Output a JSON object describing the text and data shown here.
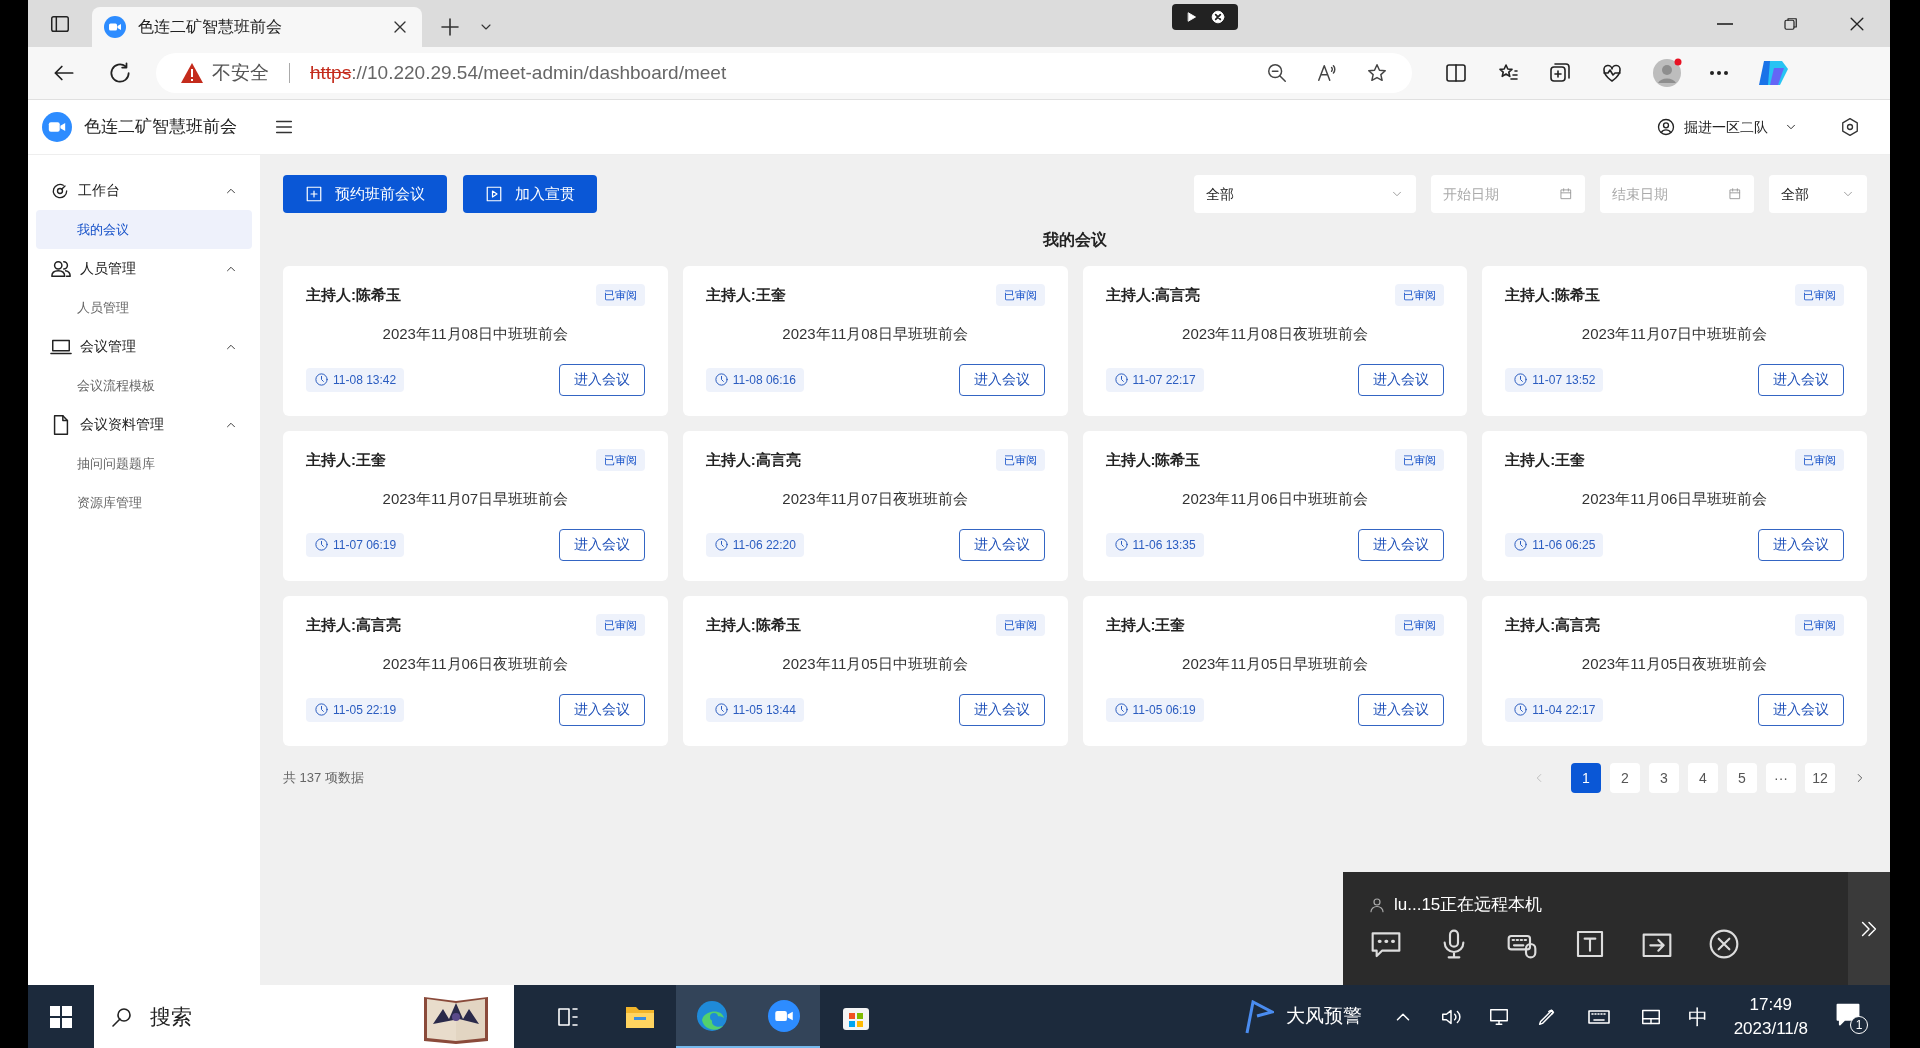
{
  "browser": {
    "tabs": [
      {
        "title": "色连二矿智慧班前会",
        "selected": true
      }
    ],
    "address": {
      "warning": "不安全",
      "scheme": "https",
      "rest": "://10.220.29.54/meet-admin/dashboard/meet"
    }
  },
  "app": {
    "title": "色连二矿智慧班前会",
    "user": "掘进一区二队"
  },
  "sidebar": [
    {
      "label": "工作台",
      "expanded": true,
      "children": [
        {
          "label": "我的会议",
          "selected": true
        }
      ]
    },
    {
      "label": "人员管理",
      "expanded": true,
      "children": [
        {
          "label": "人员管理",
          "selected": false
        }
      ]
    },
    {
      "label": "会议管理",
      "expanded": true,
      "children": [
        {
          "label": "会议流程模板",
          "selected": false
        }
      ]
    },
    {
      "label": "会议资料管理",
      "expanded": true,
      "children": [
        {
          "label": "抽问问题题库",
          "selected": false
        },
        {
          "label": "资源库管理",
          "selected": false
        }
      ]
    }
  ],
  "toolbar": [
    "预约班前会议",
    "加入宣贯"
  ],
  "filters": [
    {
      "kind": "select",
      "value": "全部"
    },
    {
      "kind": "date",
      "placeholder": "开始日期"
    },
    {
      "kind": "date",
      "placeholder": "结束日期"
    },
    {
      "kind": "select",
      "value": "全部"
    }
  ],
  "section_title": "我的会议",
  "meetings": [
    {
      "host": "主持人:陈希玉",
      "status": "已审阅",
      "title": "2023年11月08日中班班前会",
      "time": "11-08 13:42",
      "action": "进入会议"
    },
    {
      "host": "主持人:王奎",
      "status": "已审阅",
      "title": "2023年11月08日早班班前会",
      "time": "11-08 06:16",
      "action": "进入会议"
    },
    {
      "host": "主持人:高言亮",
      "status": "已审阅",
      "title": "2023年11月08日夜班班前会",
      "time": "11-07 22:17",
      "action": "进入会议"
    },
    {
      "host": "主持人:陈希玉",
      "status": "已审阅",
      "title": "2023年11月07日中班班前会",
      "time": "11-07 13:52",
      "action": "进入会议"
    },
    {
      "host": "主持人:王奎",
      "status": "已审阅",
      "title": "2023年11月07日早班班前会",
      "time": "11-07 06:19",
      "action": "进入会议"
    },
    {
      "host": "主持人:高言亮",
      "status": "已审阅",
      "title": "2023年11月07日夜班班前会",
      "time": "11-06 22:20",
      "action": "进入会议"
    },
    {
      "host": "主持人:陈希玉",
      "status": "已审阅",
      "title": "2023年11月06日中班班前会",
      "time": "11-06 13:35",
      "action": "进入会议"
    },
    {
      "host": "主持人:王奎",
      "status": "已审阅",
      "title": "2023年11月06日早班班前会",
      "time": "11-06 06:25",
      "action": "进入会议"
    },
    {
      "host": "主持人:高言亮",
      "status": "已审阅",
      "title": "2023年11月06日夜班班前会",
      "time": "11-05 22:19",
      "action": "进入会议"
    },
    {
      "host": "主持人:陈希玉",
      "status": "已审阅",
      "title": "2023年11月05日中班班前会",
      "time": "11-05 13:44",
      "action": "进入会议"
    },
    {
      "host": "主持人:王奎",
      "status": "已审阅",
      "title": "2023年11月05日早班班前会",
      "time": "11-05 06:19",
      "action": "进入会议"
    },
    {
      "host": "主持人:高言亮",
      "status": "已审阅",
      "title": "2023年11月05日夜班班前会",
      "time": "11-04 22:17",
      "action": "进入会议"
    }
  ],
  "total": "共 137 项数据",
  "pagination": [
    {
      "label": "1",
      "selected": true
    },
    {
      "label": "2",
      "selected": false
    },
    {
      "label": "3",
      "selected": false
    },
    {
      "label": "4",
      "selected": false
    },
    {
      "label": "5",
      "selected": false
    },
    {
      "label": "···",
      "selected": false
    },
    {
      "label": "12",
      "selected": false
    }
  ],
  "remote_panel": {
    "status": "lu...15正在远程本机"
  },
  "taskbar": {
    "search": "搜索",
    "weather": "大风预警",
    "ime": "中",
    "time": "17:49",
    "date": "2023/11/8",
    "notifications": "1"
  }
}
